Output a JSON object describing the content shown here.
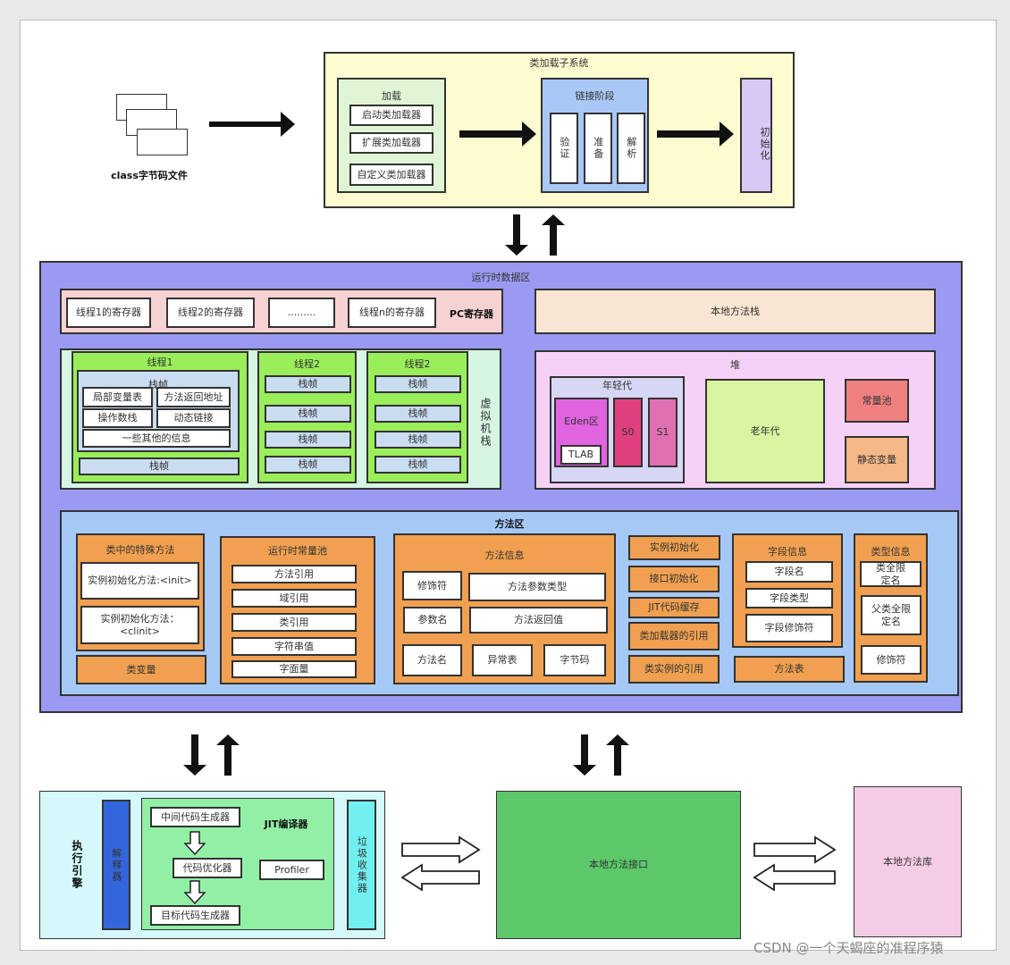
{
  "top": {
    "class_file_label": "class字节码文件",
    "class_loader_title": "类加载子系统",
    "loading": {
      "title": "加载",
      "items": [
        "启动类加载器",
        "扩展类加载器",
        "自定义类加载器"
      ]
    },
    "linking": {
      "title": "链接阶段",
      "items": [
        "验证",
        "准备",
        "解析"
      ]
    },
    "init": "初始化"
  },
  "runtime": {
    "title": "运行时数据区",
    "pc": {
      "items": [
        "线程1的寄存器",
        "线程2的寄存器",
        ".........",
        "线程n的寄存器"
      ],
      "label": "PC寄存器"
    },
    "native_stack": "本地方法栈",
    "vm_stack": {
      "label": "虚拟机栈",
      "thread1": {
        "title": "线程1",
        "frame_title": "栈帧",
        "items": [
          "局部变量表",
          "方法返回地址",
          "操作数栈",
          "动态链接",
          "一些其他的信息"
        ],
        "bottom_frame": "栈帧"
      },
      "thread2": {
        "title": "线程2",
        "frames": [
          "栈帧",
          "栈帧",
          "栈帧",
          "栈帧"
        ]
      },
      "thread3": {
        "title": "线程2",
        "frames": [
          "栈帧",
          "栈帧",
          "栈帧",
          "栈帧"
        ]
      }
    },
    "heap": {
      "title": "堆",
      "young": "年轻代",
      "eden": "Eden区",
      "tlab": "TLAB",
      "s0": "S0",
      "s1": "S1",
      "old": "老年代",
      "const_pool": "常量池",
      "static_vars": "静态变量"
    },
    "method_area": {
      "title": "方法区",
      "special": {
        "title": "类中的特殊方法",
        "items": [
          "实例初始化方法:<init>",
          "实例初始化方法：<clinit>"
        ]
      },
      "class_vars": "类变量",
      "rt_pool": {
        "title": "运行时常量池",
        "items": [
          "方法引用",
          "域引用",
          "类引用",
          "字符串值",
          "字面量"
        ]
      },
      "method_info": {
        "title": "方法信息",
        "items": [
          "修饰符",
          "方法参数类型",
          "参数名",
          "方法返回值",
          "方法名",
          "异常表",
          "字节码"
        ]
      },
      "misc": [
        "实例初始化",
        "接口初始化",
        "JIT代码缓存",
        "类加载器的引用",
        "类实例的引用"
      ],
      "field_info": {
        "title": "字段信息",
        "items": [
          "字段名",
          "字段类型",
          "字段修饰符"
        ]
      },
      "method_table": "方法表",
      "type_info": {
        "title": "类型信息",
        "items": [
          "类全限定名",
          "父类全限定名",
          "修饰符"
        ]
      }
    }
  },
  "bottom": {
    "exec_engine": "执行引擎",
    "interpreter": "解释器",
    "jit": {
      "title": "JIT编译器",
      "items": [
        "中间代码生成器",
        "代码优化器",
        "目标代码生成器"
      ],
      "profiler": "Profiler"
    },
    "gc": "垃圾收集器",
    "native_interface": "本地方法接口",
    "native_lib": "本地方法库"
  },
  "watermark": "CSDN @一个天蝎座的准程序猿"
}
